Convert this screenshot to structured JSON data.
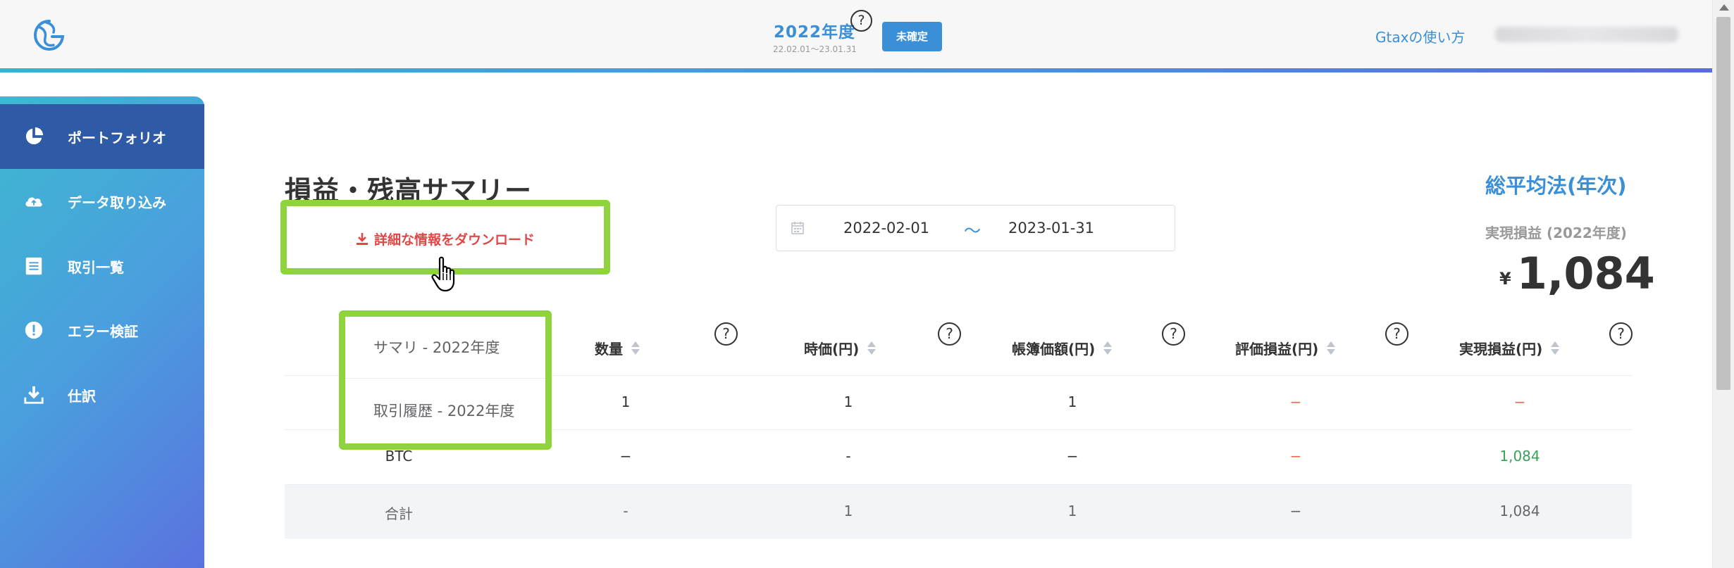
{
  "header": {
    "fiscal_year": "2022年度",
    "fiscal_range": "22.02.01〜23.01.31",
    "help_mark": "?",
    "status_badge": "未確定",
    "help_link": "Gtaxの使い方"
  },
  "sidebar": {
    "items": [
      {
        "label": "ポートフォリオ",
        "icon": "pie-chart-icon",
        "active": true
      },
      {
        "label": "データ取り込み",
        "icon": "cloud-upload-icon",
        "active": false
      },
      {
        "label": "取引一覧",
        "icon": "list-icon",
        "active": false
      },
      {
        "label": "エラー検証",
        "icon": "alert-icon",
        "active": false
      },
      {
        "label": "仕訳",
        "icon": "download-icon",
        "active": false
      }
    ]
  },
  "main": {
    "title": "損益・残高サマリー",
    "download_label": "詳細な情報をダウンロード",
    "date_start": "2022-02-01",
    "date_sep": "〜",
    "date_end": "2023-01-31",
    "method": "総平均法(年次)",
    "realized_label": "実現損益 (2022年度)",
    "currency_symbol": "¥",
    "realized_value": "1,084"
  },
  "dropdown": {
    "items": [
      "サマリ - 2022年度",
      "取引履歴 - 2022年度"
    ]
  },
  "table": {
    "headers": [
      "数量",
      "時価(円)",
      "帳簿価額(円)",
      "評価損益(円)",
      "実現損益(円)"
    ],
    "help_mark": "?",
    "rows": [
      {
        "name": "",
        "qty": "1",
        "price": "1",
        "book": "1",
        "unrealized": "−",
        "realized": "−"
      },
      {
        "name": "BTC",
        "qty": "−",
        "price": "-",
        "book": "−",
        "unrealized": "−",
        "realized": "1,084"
      },
      {
        "name": "合計",
        "qty": "-",
        "price": "1",
        "book": "1",
        "unrealized": "−",
        "realized": "1,084"
      }
    ]
  },
  "colors": {
    "accent": "#3a8fd6",
    "highlight": "#8fd43f",
    "negative": "#e06a4a",
    "positive": "#3aa05a",
    "download": "#e04848"
  }
}
